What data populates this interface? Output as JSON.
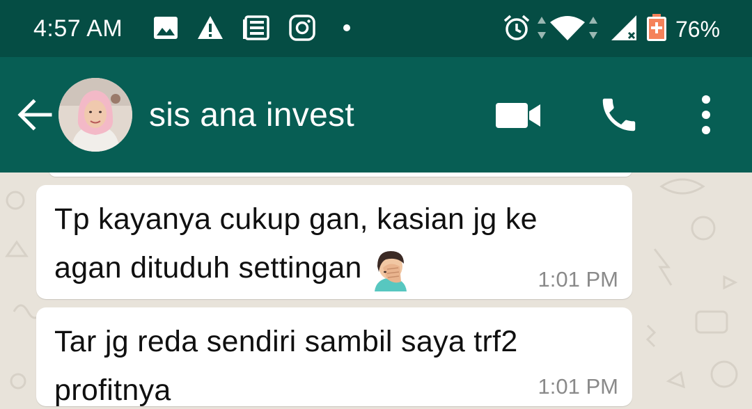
{
  "status_bar": {
    "time": "4:57 AM",
    "battery": "76%",
    "icons": [
      "image-icon",
      "warning-icon",
      "news-icon",
      "instagram-icon",
      "dot-icon",
      "alarm-icon",
      "wifi-icon",
      "signal-icon",
      "battery-icon"
    ]
  },
  "header": {
    "contact_name": "sis ana invest",
    "icons": [
      "back-arrow-icon",
      "video-call-icon",
      "phone-icon",
      "more-vert-icon"
    ]
  },
  "messages": [
    {
      "text": "Tp kayanya cukup gan, kasian jg ke agan dituduh settingan",
      "emoji": "facepalm-emoji",
      "time": "1:01 PM"
    },
    {
      "text": "Tar jg reda sendiri sambil saya trf2 profitnya",
      "time": "1:01 PM"
    }
  ],
  "colors": {
    "status_bar": "#054d44",
    "app_bar": "#075e54",
    "chat_background": "#e8e3da",
    "bubble": "#ffffff",
    "timestamp": "#8a8a8a"
  }
}
